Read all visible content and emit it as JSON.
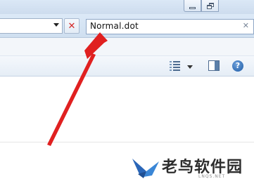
{
  "window": {
    "minimize_icon": "minimize-icon",
    "maximize_icon": "restore-icon"
  },
  "address_bar": {
    "value": "",
    "dropdown_icon": "chevron-down-icon",
    "stop_icon": "close-x-icon",
    "stop_color": "#d42626"
  },
  "search": {
    "value": "Normal.dot",
    "clear_icon": "clear-icon"
  },
  "toolbar": {
    "view_icon": "details-view-icon",
    "view_menu_icon": "chevron-down-icon",
    "preview_icon": "preview-pane-icon",
    "help_icon": "help-icon",
    "help_label": "?"
  },
  "annotation": {
    "type": "arrow",
    "color": "#e02020"
  },
  "watermark": {
    "title": "老鸟软件园",
    "subtitle": "LNQS.NET"
  }
}
